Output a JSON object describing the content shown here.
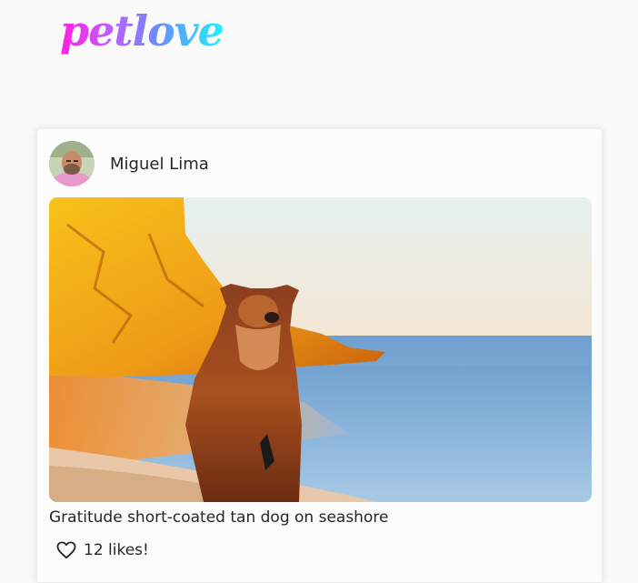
{
  "brand": {
    "logo_text": "petlove"
  },
  "post": {
    "author": "Miguel Lima",
    "caption": "Gratitude short-coated tan dog on seashore",
    "likes_text": "12 likes!"
  },
  "icons": {
    "like": "heart-outline-icon"
  }
}
